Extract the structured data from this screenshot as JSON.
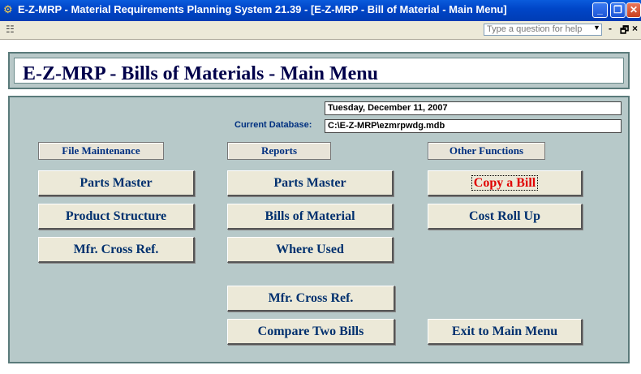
{
  "window": {
    "title": "E-Z-MRP - Material Requirements Planning System 21.39 - [E-Z-MRP - Bill of Material - Main Menu]",
    "minimize": "_",
    "restore": "❐",
    "close": "✕"
  },
  "menubar": {
    "question_placeholder": "Type a question for help",
    "mdi_minimize": "-",
    "mdi_restore": "🗗",
    "mdi_close": "×"
  },
  "header": {
    "title": "E-Z-MRP - Bills of Materials - Main Menu"
  },
  "info": {
    "date": "Tuesday, December 11, 2007",
    "db_label": "Current Database:",
    "db_path": "C:\\E-Z-MRP\\ezmrpwdg.mdb"
  },
  "sections": {
    "file_maintenance": "File Maintenance",
    "reports": "Reports",
    "other_functions": "Other Functions"
  },
  "buttons": {
    "fm_parts_master": "Parts Master",
    "fm_product_structure": "Product Structure",
    "fm_mfr_cross_ref": "Mfr. Cross Ref.",
    "rep_parts_master": "Parts Master",
    "rep_bills_of_material": "Bills of Material",
    "rep_where_used": "Where Used",
    "rep_mfr_cross_ref": "Mfr. Cross Ref.",
    "rep_compare_two_bills": "Compare Two Bills",
    "of_copy_a_bill": "Copy a Bill",
    "of_cost_roll_up": "Cost Roll Up",
    "of_exit": "Exit to Main Menu"
  }
}
